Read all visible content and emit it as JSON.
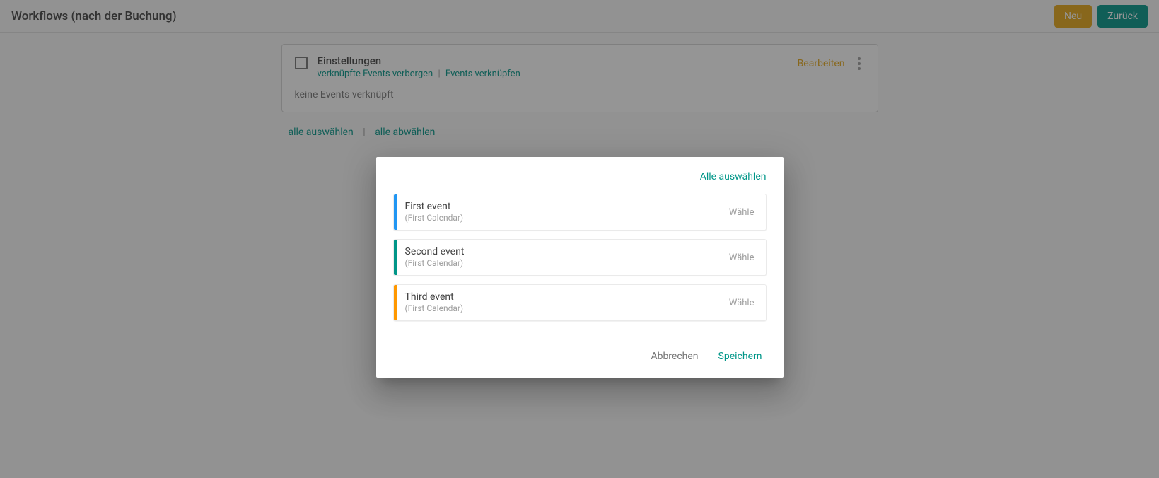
{
  "header": {
    "title": "Workflows (nach der Buchung)",
    "new_label": "Neu",
    "back_label": "Zurück"
  },
  "settings_card": {
    "title": "Einstellungen",
    "hide_linked_label": "verknüpfte Events verbergen",
    "link_events_label": "Events verknüpfen",
    "edit_label": "Bearbeiten",
    "no_events_text": "keine Events verknüpft"
  },
  "select_row": {
    "select_all": "alle auswählen",
    "deselect_all": "alle abwählen"
  },
  "modal": {
    "select_all_label": "Alle auswählen",
    "choose_label": "Wähle",
    "cancel_label": "Abbrechen",
    "save_label": "Speichern",
    "events": [
      {
        "name": "First event",
        "calendar": "(First Calendar)",
        "color": "#2196f3"
      },
      {
        "name": "Second event",
        "calendar": "(First Calendar)",
        "color": "#009688"
      },
      {
        "name": "Third event",
        "calendar": "(First Calendar)",
        "color": "#ff9800"
      }
    ]
  }
}
